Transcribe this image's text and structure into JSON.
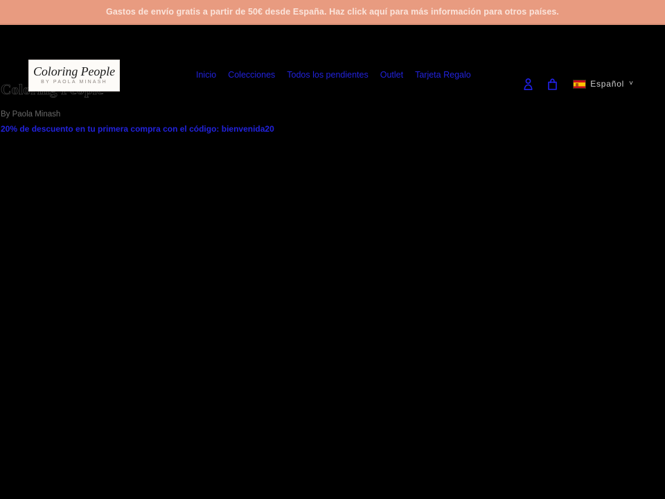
{
  "announcement": {
    "text": "Gastos de envío gratis a partir de 50€ desde España. Haz click aquí para más información para otros países.",
    "background": "#e89b80",
    "text_color": "#fbe4db"
  },
  "header": {
    "background": "#000000",
    "logo": {
      "wordmark": "Coloring People",
      "subtitle": "BY PAOLA MINASH"
    },
    "nav": [
      {
        "label": "Inicio"
      },
      {
        "label": "Colecciones"
      },
      {
        "label": "Todos los pendientes"
      },
      {
        "label": "Outlet"
      },
      {
        "label": "Tarjeta Regalo"
      }
    ],
    "nav_link_color": "#2222dd",
    "actions": {
      "account_icon": "account-icon",
      "cart_icon": "shopping-bag-icon",
      "icon_color": "#2222ee"
    },
    "locale": {
      "flag_icon": "spain-flag-icon",
      "label": "Español",
      "chevron": "˅"
    }
  },
  "main": {
    "heading": "Coloring People",
    "byline": "By Paola Minash",
    "promo_link": "20% de descuento en tu primera compra con el código: bienvenida20"
  }
}
